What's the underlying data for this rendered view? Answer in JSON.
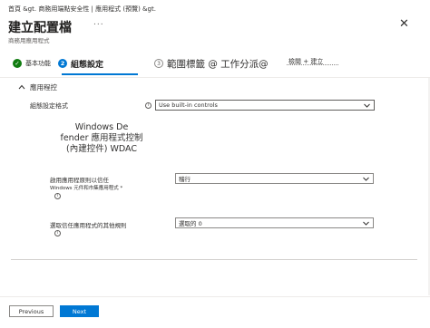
{
  "breadcrumb": "首頁 &gt. 商務用端點安全性 | 應用程式 (預覽) &gt.",
  "header": {
    "title": "建立配置檔",
    "more": "...",
    "subtitle": "商務用應用程式",
    "close": "✕"
  },
  "steps": [
    {
      "number": "✓",
      "label": "基本功能",
      "state": "done"
    },
    {
      "number": "2",
      "label": "組態設定",
      "state": "current"
    },
    {
      "number": "3",
      "label": "範圍標籤 @ 工作分派@",
      "state": "pending"
    },
    {
      "number": "",
      "label": "檢閱 + 建立",
      "state": "pending"
    }
  ],
  "section": {
    "title": "應用程控"
  },
  "fields": {
    "config_format": {
      "label": "組態設定格式",
      "info": "i",
      "value": "Use built-in controls"
    },
    "wdac_text": {
      "line1": "Windows De",
      "line2": "fender 應用程式控制",
      "line3": "(內建控件) WDAC"
    },
    "trust_rules": {
      "label_line1": "啟用應用程原則以信任",
      "label_line2": "Windows 元件和市集應用程式 *",
      "info": "i",
      "value": "稽行"
    },
    "other_rules": {
      "label": "選取信任應用程式的其他規則",
      "info": "i",
      "value": "選取的 0"
    }
  },
  "footer": {
    "previous": "Previous",
    "next": "Next"
  },
  "colors": {
    "accent": "#0078d4",
    "done": "#107c10"
  }
}
